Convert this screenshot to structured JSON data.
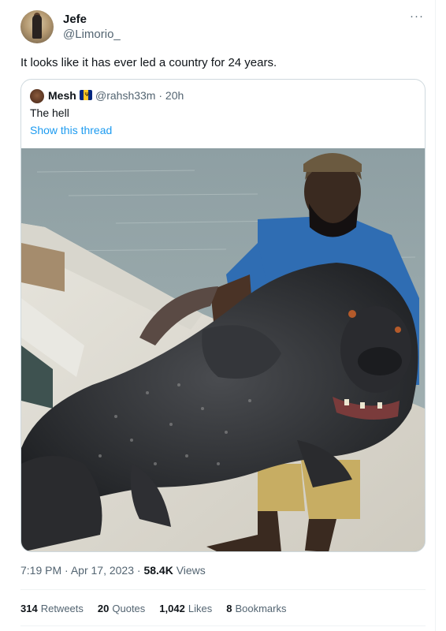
{
  "author": {
    "display_name": "Jefe",
    "handle": "@Limorio_"
  },
  "more_icon": "more-horizontal-icon",
  "tweet_text": "It looks like it has ever led a country for 24 years.",
  "quoted": {
    "display_name": "Mesh",
    "flag": "barbados-flag-icon",
    "handle": "@rahsh33m",
    "separator": "·",
    "age": "20h",
    "text": "The hell",
    "show_thread": "Show this thread"
  },
  "meta": {
    "time": "7:19 PM",
    "separator": "·",
    "date": "Apr 17, 2023",
    "views_count": "58.4K",
    "views_label": "Views"
  },
  "stats": {
    "retweets_count": "314",
    "retweets_label": "Retweets",
    "quotes_count": "20",
    "quotes_label": "Quotes",
    "likes_count": "1,042",
    "likes_label": "Likes",
    "bookmarks_count": "8",
    "bookmarks_label": "Bookmarks"
  },
  "colors": {
    "link": "#1d9bf0",
    "muted": "#536471",
    "text": "#0f1419",
    "border": "#cfd9de"
  }
}
